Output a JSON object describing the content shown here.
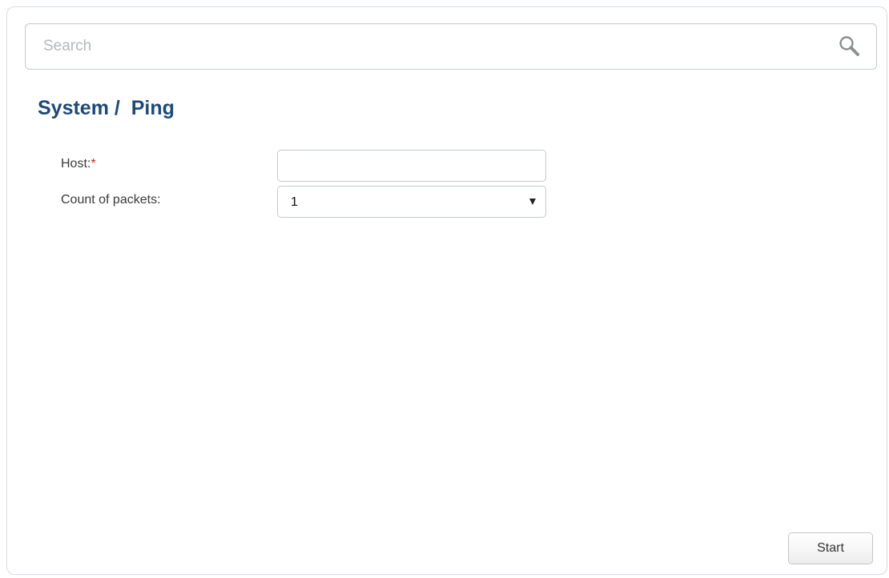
{
  "search": {
    "placeholder": "Search",
    "value": "",
    "icon": "search-icon"
  },
  "page": {
    "title": "System /  Ping"
  },
  "form": {
    "host": {
      "label": "Host:",
      "required_mark": "*",
      "value": ""
    },
    "count_of_packets": {
      "label": "Count of packets:",
      "selected_value": "1",
      "icon": "chevron-down-icon"
    }
  },
  "actions": {
    "start_label": "Start"
  },
  "colors": {
    "title": "#1c4a78",
    "required": "#d0202a",
    "border": "#c4c9ce",
    "placeholder": "#b4b8bc"
  }
}
